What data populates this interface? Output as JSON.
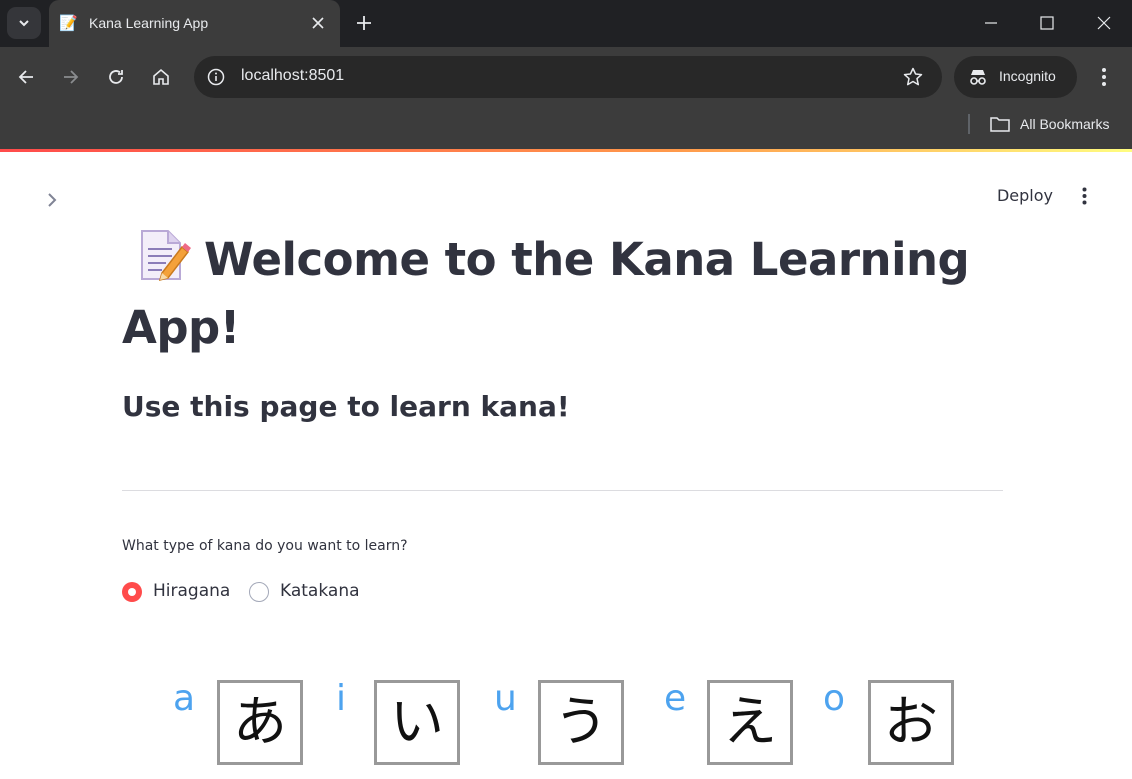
{
  "browser": {
    "tab_title": "Kana Learning App",
    "tab_favicon": "📝",
    "url": "localhost:8501",
    "incognito_label": "Incognito",
    "bookmarks_label": "All Bookmarks"
  },
  "header": {
    "deploy_label": "Deploy"
  },
  "main": {
    "title_emoji": "memo-emoji",
    "title": "Welcome to the Kana Learning App!",
    "subheader": "Use this page to learn kana!",
    "radio": {
      "label": "What type of kana do you want to learn?",
      "options": [
        "Hiragana",
        "Katakana"
      ],
      "selected": "Hiragana"
    },
    "kana": [
      {
        "romaji": "a",
        "char": "あ"
      },
      {
        "romaji": "i",
        "char": "い"
      },
      {
        "romaji": "u",
        "char": "う"
      },
      {
        "romaji": "e",
        "char": "え"
      },
      {
        "romaji": "o",
        "char": "お"
      }
    ]
  },
  "colors": {
    "accent": "#ff4b4b",
    "romaji": "#4da3ef",
    "text": "#31333f"
  }
}
